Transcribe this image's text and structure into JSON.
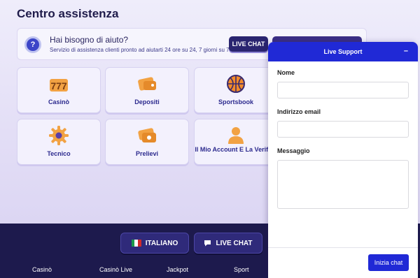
{
  "page": {
    "title": "Centro assistenza"
  },
  "help_banner": {
    "title": "Hai bisogno di aiuto?",
    "subtitle": "Servizio di assistenza clienti pronto ad aiutarti 24 ore su 24, 7 giorni su 7.",
    "live_chat_label": "LIVE CHAT"
  },
  "categories": [
    {
      "label": "Casinò",
      "icon": "slot-777-icon"
    },
    {
      "label": "Depositi",
      "icon": "wallet-icon"
    },
    {
      "label": "Sportsbook",
      "icon": "basketball-icon"
    },
    {
      "label": "Tecnico",
      "icon": "gear-icon"
    },
    {
      "label": "Prelievi",
      "icon": "cash-icon"
    },
    {
      "label": "Il Mio Account E La Verifica",
      "icon": "user-icon"
    }
  ],
  "footer": {
    "language_label": "ITALIANO",
    "live_chat_label": "LIVE CHAT",
    "links": [
      "Casinò",
      "Casinò Live",
      "Jackpot",
      "Sport"
    ]
  },
  "chat": {
    "title": "Live Support",
    "minimize_symbol": "–",
    "name_label": "Nome",
    "email_label": "Indirizzo email",
    "message_label": "Messaggio",
    "submit_label": "Inizia chat"
  },
  "colors": {
    "accent": "#2029d6",
    "footer_bg": "#1d1a4d",
    "tile_text": "#2c2a8e"
  }
}
